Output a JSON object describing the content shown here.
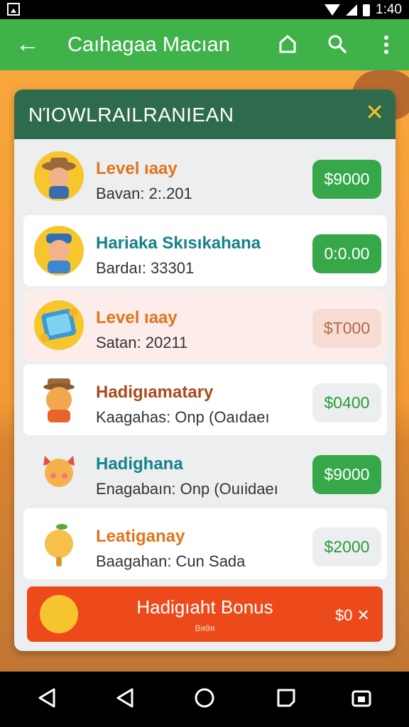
{
  "status_bar": {
    "time": "1:40"
  },
  "app_bar": {
    "back_glyph": "←",
    "title": "Caıhagaa Macıan"
  },
  "dialog": {
    "title": "NΊOWLRAILRANIEAN",
    "close_glyph": "✕",
    "rows": [
      {
        "title": "Level ıaay",
        "subtitle": "Bavan: 2:.201",
        "price": "$9000",
        "title_color": "#e0751a",
        "price_bg": "#36a84a",
        "price_color": "#ffffff"
      },
      {
        "title": "Hariaka Skısıkahana",
        "subtitle": "Bardaı: 33301",
        "price": "0:0.00",
        "title_color": "#15838a",
        "price_bg": "#36a84a",
        "price_color": "#ffffff"
      },
      {
        "title": "Level ıaay",
        "subtitle": "Satan: 20211",
        "price": "$T000",
        "title_color": "#e0751a",
        "price_bg": "#f6dcd3",
        "price_color": "#b06a4a"
      },
      {
        "title": "Hadigıamatary",
        "subtitle": "Kaagahas: Onp (Oaıdaeı",
        "price": "$0400",
        "title_color": "#a84a1e",
        "price_bg": "#eceef0",
        "price_color": "#2a9a3c"
      },
      {
        "title": "Hadighana",
        "subtitle": "Enagabaın: Onp (Ouıidaeı",
        "price": "$9000",
        "title_color": "#15838a",
        "price_bg": "#36a84a",
        "price_color": "#ffffff"
      },
      {
        "title": "Leatiganay",
        "subtitle": "Baagahan: Cun Sada",
        "price": "$2000",
        "title_color": "#e0751a",
        "price_bg": "#eceef0",
        "price_color": "#2a9a3c"
      }
    ],
    "bonus": {
      "title": "Hadigıaht Bonus",
      "subtitle": "Bᴙ9ᴙ",
      "price": "$0 ✕"
    }
  }
}
